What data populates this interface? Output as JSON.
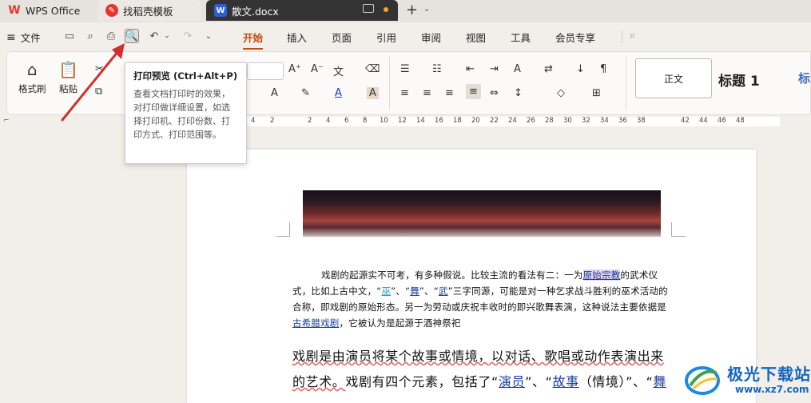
{
  "tabs": {
    "wps": "WPS Office",
    "template": "找稻壳模板",
    "document": "散文.docx",
    "new_tab": "+"
  },
  "menu": {
    "file": "文件",
    "tabs": [
      "开始",
      "插入",
      "页面",
      "引用",
      "审阅",
      "视图",
      "工具",
      "会员专享"
    ],
    "active_tab": "开始"
  },
  "ribbon": {
    "format_painter": "格式刷",
    "paste": "粘贴",
    "style_normal": "正文",
    "style_heading1": "标题 1",
    "style_heading2": "标"
  },
  "tooltip": {
    "title": "打印预览 (Ctrl+Alt+P)",
    "body": "查看文档打印时的效果，对打印做详细设置，如选择打印机、打印份数、打印方式、打印范围等。"
  },
  "ruler": {
    "numbers": [
      "4",
      "2",
      "2",
      "4",
      "6",
      "8",
      "10",
      "12",
      "14",
      "16",
      "18",
      "20",
      "22",
      "24",
      "26",
      "28",
      "30",
      "32",
      "34",
      "36",
      "38",
      "42",
      "44",
      "46",
      "48"
    ]
  },
  "document": {
    "para1": {
      "t1": "戏剧的起源实不可考，有多种假说。比较主流的看法有二：一为",
      "l1": "原始宗教",
      "t2": "的武术仪式，比如上古中文，“",
      "l2": "巫",
      "t3": "”、“",
      "l3": "舞",
      "t4": "”、“",
      "l4": "武",
      "t5": "”三字同源，可能是对一种乞求战斗胜利的巫术活动的合称，即戏剧的原始形态。另一为劳动或庆祝丰收时的即兴歌舞表演，这种说法主要依据是",
      "l5": "古希腊戏剧",
      "t6": "，它被认为是起源于酒神祭祀"
    },
    "para2": {
      "t1": "戏剧是由演员将某个故事或情境，以对话、歌唱或动作表演出来的艺术。",
      "t2": "戏剧有四个元素，包括了“",
      "l1": "演员",
      "t3": "”、“",
      "l2": "故事",
      "t4": "（情境）”、“",
      "l3": "舞"
    }
  },
  "watermark": {
    "name": "极光下载站",
    "url": "www.xz7.com"
  },
  "colors": {
    "accent": "#c34a16",
    "link": "#1a3c9c",
    "annotation_arrow": "#d32f2f"
  }
}
